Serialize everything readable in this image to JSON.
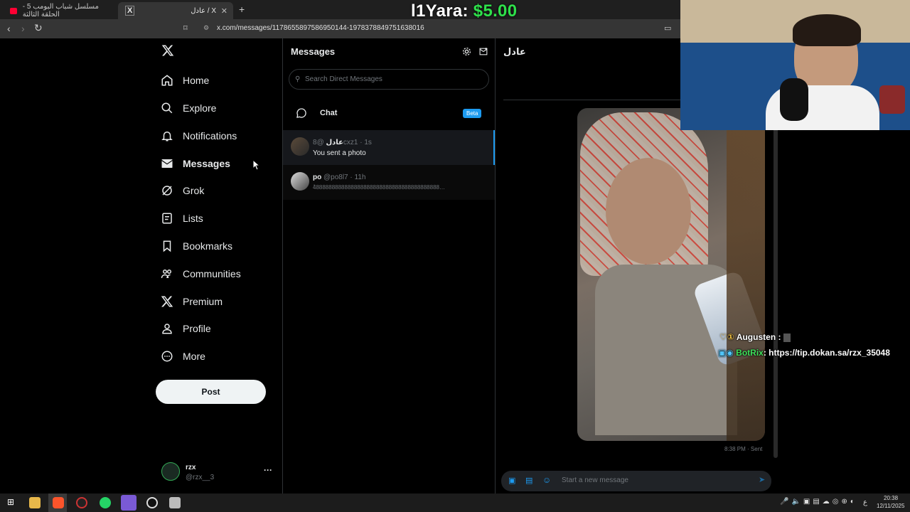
{
  "browser": {
    "tab1_title": "مسلسل شباب البومب 5 - الحلقة الثالثة",
    "tab2_title": "عادل / X",
    "url": "x.com/messages/1178655897586950144-1978378849751638016"
  },
  "overlay": {
    "donor": "l1Yara:",
    "amount": "$5.00",
    "chat": [
      {
        "user": "Augusten :",
        "text": ""
      },
      {
        "user": "BotRix",
        "text": ": https://tip.dokan.sa/rzx_35048"
      }
    ]
  },
  "sidebar": {
    "items": [
      {
        "label": "Home",
        "icon": "home-icon"
      },
      {
        "label": "Explore",
        "icon": "search-icon"
      },
      {
        "label": "Notifications",
        "icon": "bell-icon"
      },
      {
        "label": "Messages",
        "icon": "envelope-icon"
      },
      {
        "label": "Grok",
        "icon": "grok-icon"
      },
      {
        "label": "Lists",
        "icon": "list-icon"
      },
      {
        "label": "Bookmarks",
        "icon": "bookmark-icon"
      },
      {
        "label": "Communities",
        "icon": "people-icon"
      },
      {
        "label": "Premium",
        "icon": "x-logo-icon"
      },
      {
        "label": "Profile",
        "icon": "person-icon"
      },
      {
        "label": "More",
        "icon": "more-icon"
      }
    ],
    "post_label": "Post",
    "account": {
      "name": "rzx",
      "handle": "@rzx__3"
    }
  },
  "messages": {
    "title": "Messages",
    "search_placeholder": "Search Direct Messages",
    "chat_label": "Chat",
    "beta_label": "Beta",
    "conversations": [
      {
        "name": "عادل",
        "handle": "@8cxz1 · 1s",
        "preview": "You sent a photo"
      },
      {
        "name": "po",
        "handle": "@po8l7 · 11h",
        "preview": "ٔ4888888888888888888888888888888888888888…"
      }
    ]
  },
  "chat": {
    "title": "عادل",
    "timestamp": "8:38 PM · Sent",
    "composer_placeholder": "Start a new message"
  },
  "taskbar": {
    "time": "20:38",
    "date": "12/11/2025",
    "lang": "ع"
  },
  "colors": {
    "accent": "#1d9bf0",
    "donation_green": "#2ee04a"
  }
}
